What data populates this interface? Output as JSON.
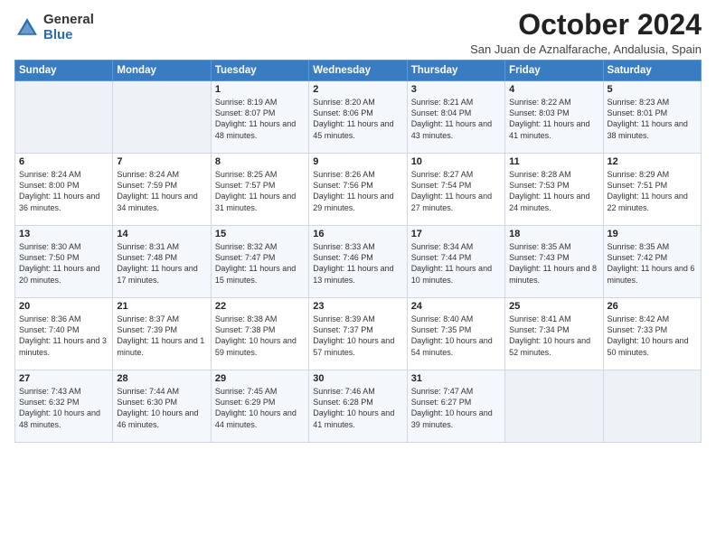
{
  "logo": {
    "general": "General",
    "blue": "Blue"
  },
  "header": {
    "month": "October 2024",
    "location": "San Juan de Aznalfarache, Andalusia, Spain"
  },
  "days_of_week": [
    "Sunday",
    "Monday",
    "Tuesday",
    "Wednesday",
    "Thursday",
    "Friday",
    "Saturday"
  ],
  "weeks": [
    [
      {
        "day": "",
        "info": ""
      },
      {
        "day": "",
        "info": ""
      },
      {
        "day": "1",
        "info": "Sunrise: 8:19 AM\nSunset: 8:07 PM\nDaylight: 11 hours and 48 minutes."
      },
      {
        "day": "2",
        "info": "Sunrise: 8:20 AM\nSunset: 8:06 PM\nDaylight: 11 hours and 45 minutes."
      },
      {
        "day": "3",
        "info": "Sunrise: 8:21 AM\nSunset: 8:04 PM\nDaylight: 11 hours and 43 minutes."
      },
      {
        "day": "4",
        "info": "Sunrise: 8:22 AM\nSunset: 8:03 PM\nDaylight: 11 hours and 41 minutes."
      },
      {
        "day": "5",
        "info": "Sunrise: 8:23 AM\nSunset: 8:01 PM\nDaylight: 11 hours and 38 minutes."
      }
    ],
    [
      {
        "day": "6",
        "info": "Sunrise: 8:24 AM\nSunset: 8:00 PM\nDaylight: 11 hours and 36 minutes."
      },
      {
        "day": "7",
        "info": "Sunrise: 8:24 AM\nSunset: 7:59 PM\nDaylight: 11 hours and 34 minutes."
      },
      {
        "day": "8",
        "info": "Sunrise: 8:25 AM\nSunset: 7:57 PM\nDaylight: 11 hours and 31 minutes."
      },
      {
        "day": "9",
        "info": "Sunrise: 8:26 AM\nSunset: 7:56 PM\nDaylight: 11 hours and 29 minutes."
      },
      {
        "day": "10",
        "info": "Sunrise: 8:27 AM\nSunset: 7:54 PM\nDaylight: 11 hours and 27 minutes."
      },
      {
        "day": "11",
        "info": "Sunrise: 8:28 AM\nSunset: 7:53 PM\nDaylight: 11 hours and 24 minutes."
      },
      {
        "day": "12",
        "info": "Sunrise: 8:29 AM\nSunset: 7:51 PM\nDaylight: 11 hours and 22 minutes."
      }
    ],
    [
      {
        "day": "13",
        "info": "Sunrise: 8:30 AM\nSunset: 7:50 PM\nDaylight: 11 hours and 20 minutes."
      },
      {
        "day": "14",
        "info": "Sunrise: 8:31 AM\nSunset: 7:48 PM\nDaylight: 11 hours and 17 minutes."
      },
      {
        "day": "15",
        "info": "Sunrise: 8:32 AM\nSunset: 7:47 PM\nDaylight: 11 hours and 15 minutes."
      },
      {
        "day": "16",
        "info": "Sunrise: 8:33 AM\nSunset: 7:46 PM\nDaylight: 11 hours and 13 minutes."
      },
      {
        "day": "17",
        "info": "Sunrise: 8:34 AM\nSunset: 7:44 PM\nDaylight: 11 hours and 10 minutes."
      },
      {
        "day": "18",
        "info": "Sunrise: 8:35 AM\nSunset: 7:43 PM\nDaylight: 11 hours and 8 minutes."
      },
      {
        "day": "19",
        "info": "Sunrise: 8:35 AM\nSunset: 7:42 PM\nDaylight: 11 hours and 6 minutes."
      }
    ],
    [
      {
        "day": "20",
        "info": "Sunrise: 8:36 AM\nSunset: 7:40 PM\nDaylight: 11 hours and 3 minutes."
      },
      {
        "day": "21",
        "info": "Sunrise: 8:37 AM\nSunset: 7:39 PM\nDaylight: 11 hours and 1 minute."
      },
      {
        "day": "22",
        "info": "Sunrise: 8:38 AM\nSunset: 7:38 PM\nDaylight: 10 hours and 59 minutes."
      },
      {
        "day": "23",
        "info": "Sunrise: 8:39 AM\nSunset: 7:37 PM\nDaylight: 10 hours and 57 minutes."
      },
      {
        "day": "24",
        "info": "Sunrise: 8:40 AM\nSunset: 7:35 PM\nDaylight: 10 hours and 54 minutes."
      },
      {
        "day": "25",
        "info": "Sunrise: 8:41 AM\nSunset: 7:34 PM\nDaylight: 10 hours and 52 minutes."
      },
      {
        "day": "26",
        "info": "Sunrise: 8:42 AM\nSunset: 7:33 PM\nDaylight: 10 hours and 50 minutes."
      }
    ],
    [
      {
        "day": "27",
        "info": "Sunrise: 7:43 AM\nSunset: 6:32 PM\nDaylight: 10 hours and 48 minutes."
      },
      {
        "day": "28",
        "info": "Sunrise: 7:44 AM\nSunset: 6:30 PM\nDaylight: 10 hours and 46 minutes."
      },
      {
        "day": "29",
        "info": "Sunrise: 7:45 AM\nSunset: 6:29 PM\nDaylight: 10 hours and 44 minutes."
      },
      {
        "day": "30",
        "info": "Sunrise: 7:46 AM\nSunset: 6:28 PM\nDaylight: 10 hours and 41 minutes."
      },
      {
        "day": "31",
        "info": "Sunrise: 7:47 AM\nSunset: 6:27 PM\nDaylight: 10 hours and 39 minutes."
      },
      {
        "day": "",
        "info": ""
      },
      {
        "day": "",
        "info": ""
      }
    ]
  ]
}
